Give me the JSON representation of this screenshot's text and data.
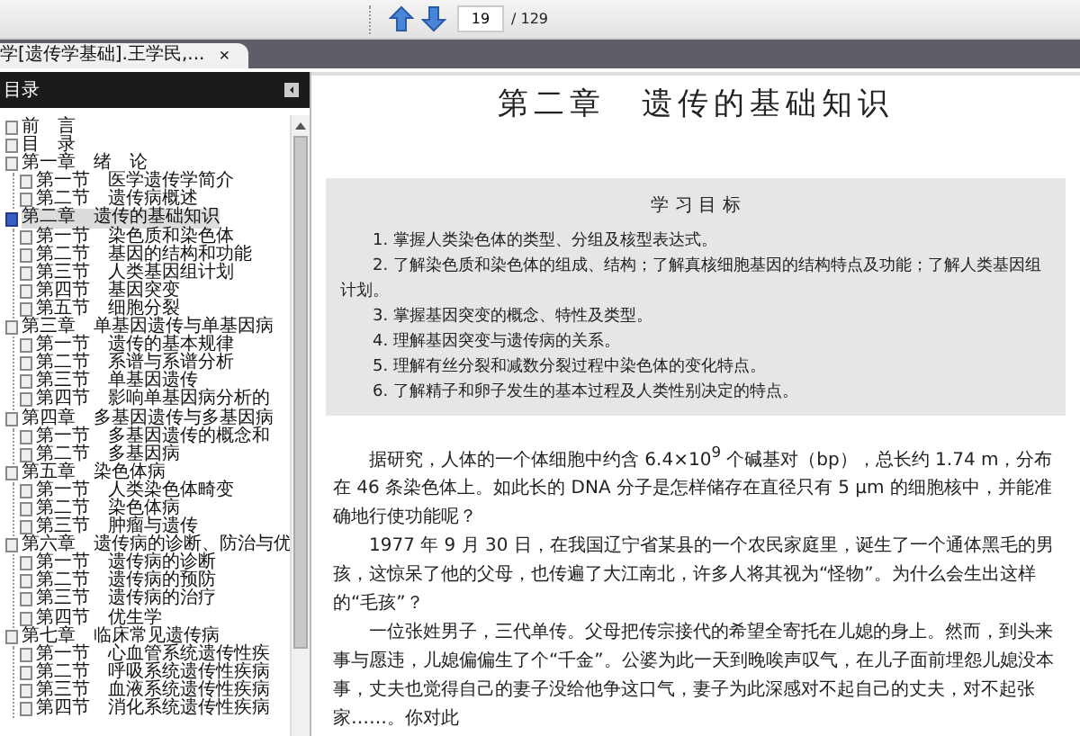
{
  "toolbar": {
    "page_field": {
      "value": "19"
    },
    "page_total": "/ 129"
  },
  "tab": {
    "title": "学[遗传学基础].王学民,...",
    "close": "×"
  },
  "sidebar": {
    "title": "目录",
    "tree": [
      {
        "label": "前　言",
        "selected": false
      },
      {
        "label": "目　录",
        "selected": false
      },
      {
        "label": "第一章　绪　论",
        "selected": false,
        "children": [
          {
            "label": "第一节　医学遗传学简介",
            "selected": false
          },
          {
            "label": "第二节　遗传病概述",
            "selected": false
          }
        ]
      },
      {
        "label": "第二章　遗传的基础知识",
        "selected": true,
        "children": [
          {
            "label": "第一节　染色质和染色体",
            "selected": false
          },
          {
            "label": "第二节　基因的结构和功能",
            "selected": false
          },
          {
            "label": "第三节　人类基因组计划",
            "selected": false
          },
          {
            "label": "第四节　基因突变",
            "selected": false
          },
          {
            "label": "第五节　细胞分裂",
            "selected": false
          }
        ]
      },
      {
        "label": "第三章　单基因遗传与单基因病",
        "selected": false,
        "children": [
          {
            "label": "第一节　遗传的基本规律",
            "selected": false
          },
          {
            "label": "第二节　系谱与系谱分析",
            "selected": false
          },
          {
            "label": "第三节　单基因遗传",
            "selected": false
          },
          {
            "label": "第四节　影响单基因病分析的",
            "selected": false
          }
        ]
      },
      {
        "label": "第四章　多基因遗传与多基因病",
        "selected": false,
        "children": [
          {
            "label": "第一节　多基因遗传的概念和",
            "selected": false
          },
          {
            "label": "第二节　多基因病",
            "selected": false
          }
        ]
      },
      {
        "label": "第五章　染色体病",
        "selected": false,
        "children": [
          {
            "label": "第一节　人类染色体畸变",
            "selected": false
          },
          {
            "label": "第二节　染色体病",
            "selected": false
          },
          {
            "label": "第三节　肿瘤与遗传",
            "selected": false
          }
        ]
      },
      {
        "label": "第六章　遗传病的诊断、防治与优",
        "selected": false,
        "children": [
          {
            "label": "第一节　遗传病的诊断",
            "selected": false
          },
          {
            "label": "第二节　遗传病的预防",
            "selected": false
          },
          {
            "label": "第三节　遗传病的治疗",
            "selected": false
          },
          {
            "label": "第四节　优生学",
            "selected": false
          }
        ]
      },
      {
        "label": "第七章　临床常见遗传病",
        "selected": false,
        "children": [
          {
            "label": "第一节　心血管系统遗传性疾",
            "selected": false
          },
          {
            "label": "第二节　呼吸系统遗传性疾病",
            "selected": false
          },
          {
            "label": "第三节　血液系统遗传性疾病",
            "selected": false
          },
          {
            "label": "第四节　消化系统遗传性疾病",
            "selected": false
          }
        ]
      }
    ]
  },
  "page": {
    "title": "第二章　遗传的基础知识",
    "objectives": {
      "heading": "学 习 目 标",
      "items": [
        "1. 掌握人类染色体的类型、分组及核型表达式。",
        "2. 了解染色质和染色体的组成、结构；了解真核细胞基因的结构特点及功能；了解人类基因组计划。",
        "3. 掌握基因突变的概念、特性及类型。",
        "4. 理解基因突变与遗传病的关系。",
        "5. 理解有丝分裂和减数分裂过程中染色体的变化特点。",
        "6. 了解精子和卵子发生的基本过程及人类性别决定的特点。"
      ]
    },
    "paragraphs": [
      "据研究，人体的一个体细胞中约含 6.4×10$^{9}$ 个碱基对（bp），总长约 1.74 m，分布在 46 条染色体上。如此长的 DNA 分子是怎样储存在直径只有 5 μm 的细胞核中，并能准确地行使功能呢？",
      "1977 年 9 月 30 日，在我国辽宁省某县的一个农民家庭里，诞生了一个通体黑毛的男孩，这惊呆了他的父母，也传遍了大江南北，许多人将其视为“怪物”。为什么会生出这样的“毛孩”？",
      "一位张姓男子，三代单传。父母把传宗接代的希望全寄托在儿媳的身上。然而，到头来事与愿违，儿媳偏偏生了个“千金”。公婆为此一天到晚唉声叹气，在儿子面前埋怨儿媳没本事，丈夫也觉得自己的妻子没给他争这口气，妻子为此深感对不起自己的丈夫，对不起张家……。你对此"
    ]
  }
}
